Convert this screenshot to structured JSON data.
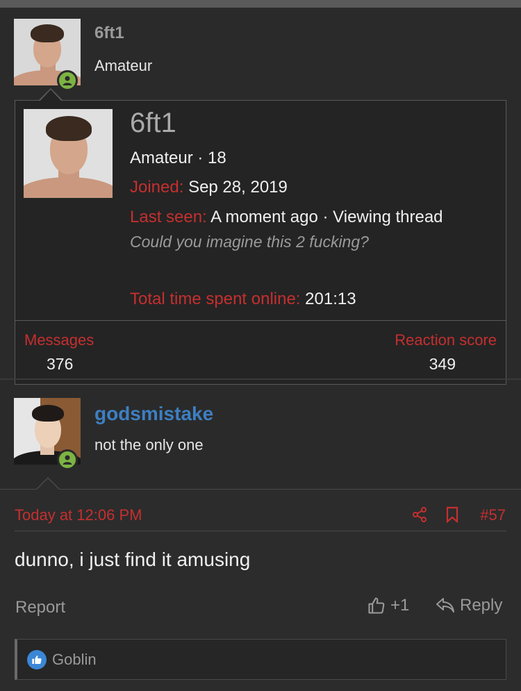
{
  "post_header": {
    "username": "6ft1",
    "user_title": "Amateur"
  },
  "tooltip": {
    "username": "6ft1",
    "user_title_age": "Amateur · 18",
    "joined_label": "Joined:",
    "joined_value": "Sep 28, 2019",
    "last_seen_label": "Last seen:",
    "last_seen_value": "A moment ago · Viewing thread",
    "status": "Could you imagine this 2 fucking?",
    "time_online_label": "Total time spent online:",
    "time_online_value": "201:13",
    "messages_label": "Messages",
    "messages_value": "376",
    "reaction_label": "Reaction score",
    "reaction_value": "349"
  },
  "post": {
    "username": "godsmistake",
    "user_title": "not the only one",
    "timestamp": "Today at 12:06 PM",
    "post_number": "#57",
    "message": "dunno, i just find it amusing",
    "report_label": "Report",
    "like_count": "+1",
    "reply_label": "Reply",
    "reactions": {
      "users": "Goblin"
    }
  },
  "colors": {
    "accent_red": "#c62f2f",
    "username_blue": "#3d7fc2",
    "online_green": "#7cb342",
    "like_blue": "#3b87d6"
  }
}
